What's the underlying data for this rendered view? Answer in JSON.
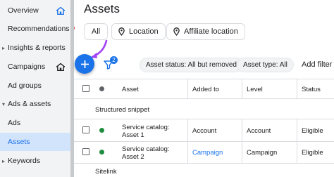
{
  "sidebar": {
    "items": [
      {
        "label": "Overview"
      },
      {
        "label": "Recommendations"
      },
      {
        "label": "Insights & reports"
      },
      {
        "label": "Campaigns"
      },
      {
        "label": "Ad groups"
      },
      {
        "label": "Ads & assets"
      },
      {
        "label": "Ads"
      },
      {
        "label": "Assets"
      },
      {
        "label": "Keywords"
      }
    ]
  },
  "header": {
    "title": "Assets"
  },
  "chips": {
    "all": "All",
    "location": "Location",
    "affiliate_location": "Affiliate location"
  },
  "toolbar": {
    "add_symbol": "+",
    "filter_badge": "2",
    "filters": [
      {
        "label": "Asset status: All but removed"
      },
      {
        "label": "Asset type: All"
      }
    ],
    "add_filter": "Add filter"
  },
  "table": {
    "columns": [
      "Asset",
      "Added to",
      "Level",
      "Status"
    ],
    "groups": [
      "Structured snippet",
      "Sitelink"
    ],
    "rows": [
      {
        "asset_line1": "Service catalog:",
        "asset_line2": "Asset 1",
        "added_to": "Account",
        "level": "Account",
        "status": "Eligible"
      },
      {
        "asset_line1": "Service catalog:",
        "asset_line2": "Asset 2",
        "added_to": "Campaign",
        "level": "Campaign",
        "status": "Eligible"
      }
    ]
  },
  "colors": {
    "accent": "#1a73e8",
    "status_enabled": "#1e8e3e",
    "header_status_dot": "#5f6368",
    "notification": "#d93025",
    "arrow": "#a142f4"
  },
  "icons": {
    "home": "home-icon",
    "location": "location-pin-icon",
    "filter": "filter-icon",
    "add": "plus-icon"
  }
}
